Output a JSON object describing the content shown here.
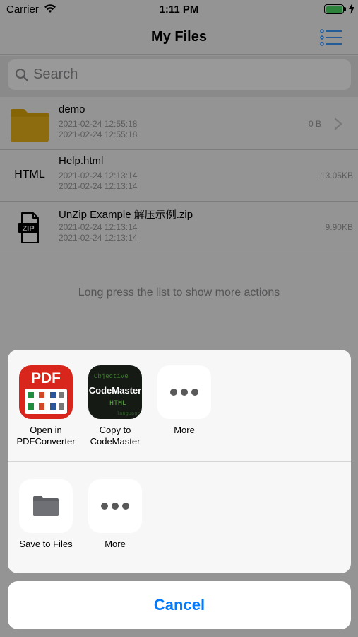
{
  "status_bar": {
    "carrier": "Carrier",
    "time": "1:11 PM"
  },
  "nav": {
    "title": "My Files"
  },
  "search": {
    "placeholder": "Search"
  },
  "files": [
    {
      "name": "demo",
      "created": "2021-02-24 12:55:18",
      "modified": "2021-02-24 12:55:18",
      "size": "0 B",
      "type": "folder-icon"
    },
    {
      "name": "Help.html",
      "created": "2021-02-24 12:13:14",
      "modified": "2021-02-24 12:13:14",
      "size": "13.05KB",
      "thumb_text": "HTML"
    },
    {
      "name": "UnZip Example 解压示例.zip",
      "created": "2021-02-24 12:13:14",
      "modified": "2021-02-24 12:13:14",
      "size": "9.90KB",
      "type": "zip-icon"
    }
  ],
  "hint": "Long press the list to show more actions",
  "share_sheet": {
    "apps": [
      {
        "label_line1": "Open in",
        "label_line2": "PDFConverter",
        "icon": "pdfconverter-app-icon",
        "icon_text": "PDF"
      },
      {
        "label_line1": "Copy to",
        "label_line2": "CodeMaster",
        "icon": "codemaster-app-icon",
        "icon_text": "CodeMaster"
      },
      {
        "label_line1": "More",
        "label_line2": "",
        "icon": "more-icon"
      }
    ],
    "actions": [
      {
        "label": "Save to Files",
        "icon": "folder-icon"
      },
      {
        "label": "More",
        "icon": "more-icon"
      }
    ],
    "cancel_label": "Cancel"
  },
  "colors": {
    "accent": "#007aff",
    "battery": "#4cd964",
    "folder": "#e0a80c",
    "pdf_red": "#d9261c"
  }
}
